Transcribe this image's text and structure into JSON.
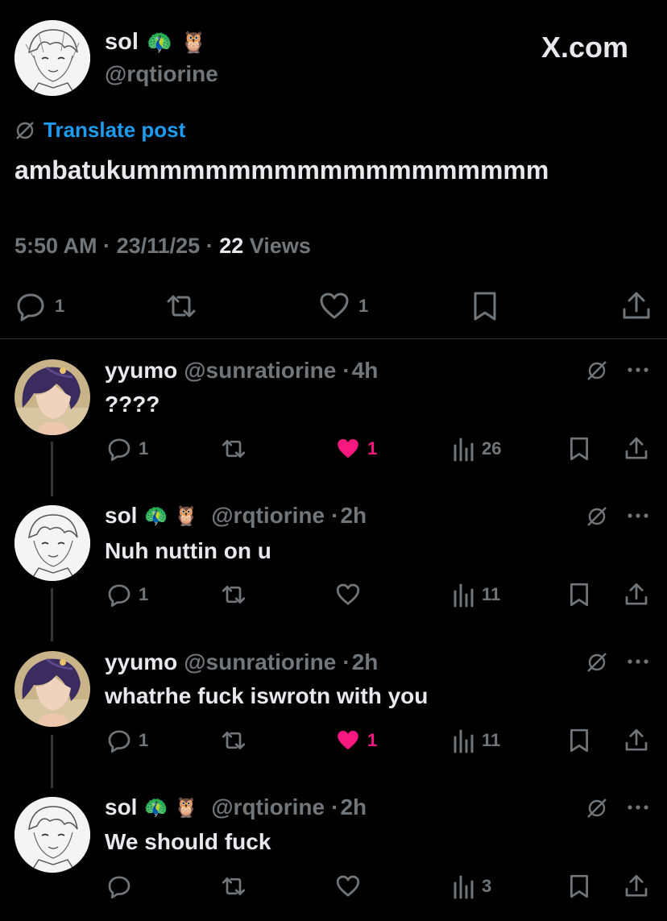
{
  "brand": {
    "watermark": "X.com"
  },
  "post": {
    "author_name": "sol",
    "author_emoji_1": "🦚",
    "author_emoji_2": "🦉",
    "author_handle": "@rqtiorine",
    "translate_label": "Translate post",
    "text": "ambatukummmmmmmmmmmmmmmmmm",
    "time": "5:50 AM",
    "sep": "·",
    "date": "23/11/25",
    "views_count": "22",
    "views_label": "Views",
    "replies": "1",
    "likes": "1",
    "accent_blue": "#1d9bf0",
    "like_pink": "#f91880"
  },
  "replies": [
    {
      "name": "yyumo",
      "handle": "@sunratiorine",
      "time": "4h",
      "text": "????",
      "replies": "1",
      "likes": "1",
      "liked": true,
      "views": "26",
      "avatar": "purple-hair-avatar"
    },
    {
      "name": "sol",
      "emoji_1": "🦚",
      "emoji_2": "🦉",
      "handle": "@rqtiorine",
      "time": "2h",
      "text": "Nuh nuttin on u",
      "replies": "1",
      "likes": "",
      "liked": false,
      "views": "11",
      "avatar": "sketch-avatar"
    },
    {
      "name": "yyumo",
      "handle": "@sunratiorine",
      "time": "2h",
      "text": "whatrhe fuck iswrotn with you",
      "replies": "1",
      "likes": "1",
      "liked": true,
      "views": "11",
      "avatar": "purple-hair-avatar"
    },
    {
      "name": "sol",
      "emoji_1": "🦚",
      "emoji_2": "🦉",
      "handle": "@rqtiorine",
      "time": "2h",
      "text": "We should fuck",
      "replies": "",
      "likes": "",
      "liked": false,
      "views": "3",
      "avatar": "sketch-avatar"
    }
  ]
}
